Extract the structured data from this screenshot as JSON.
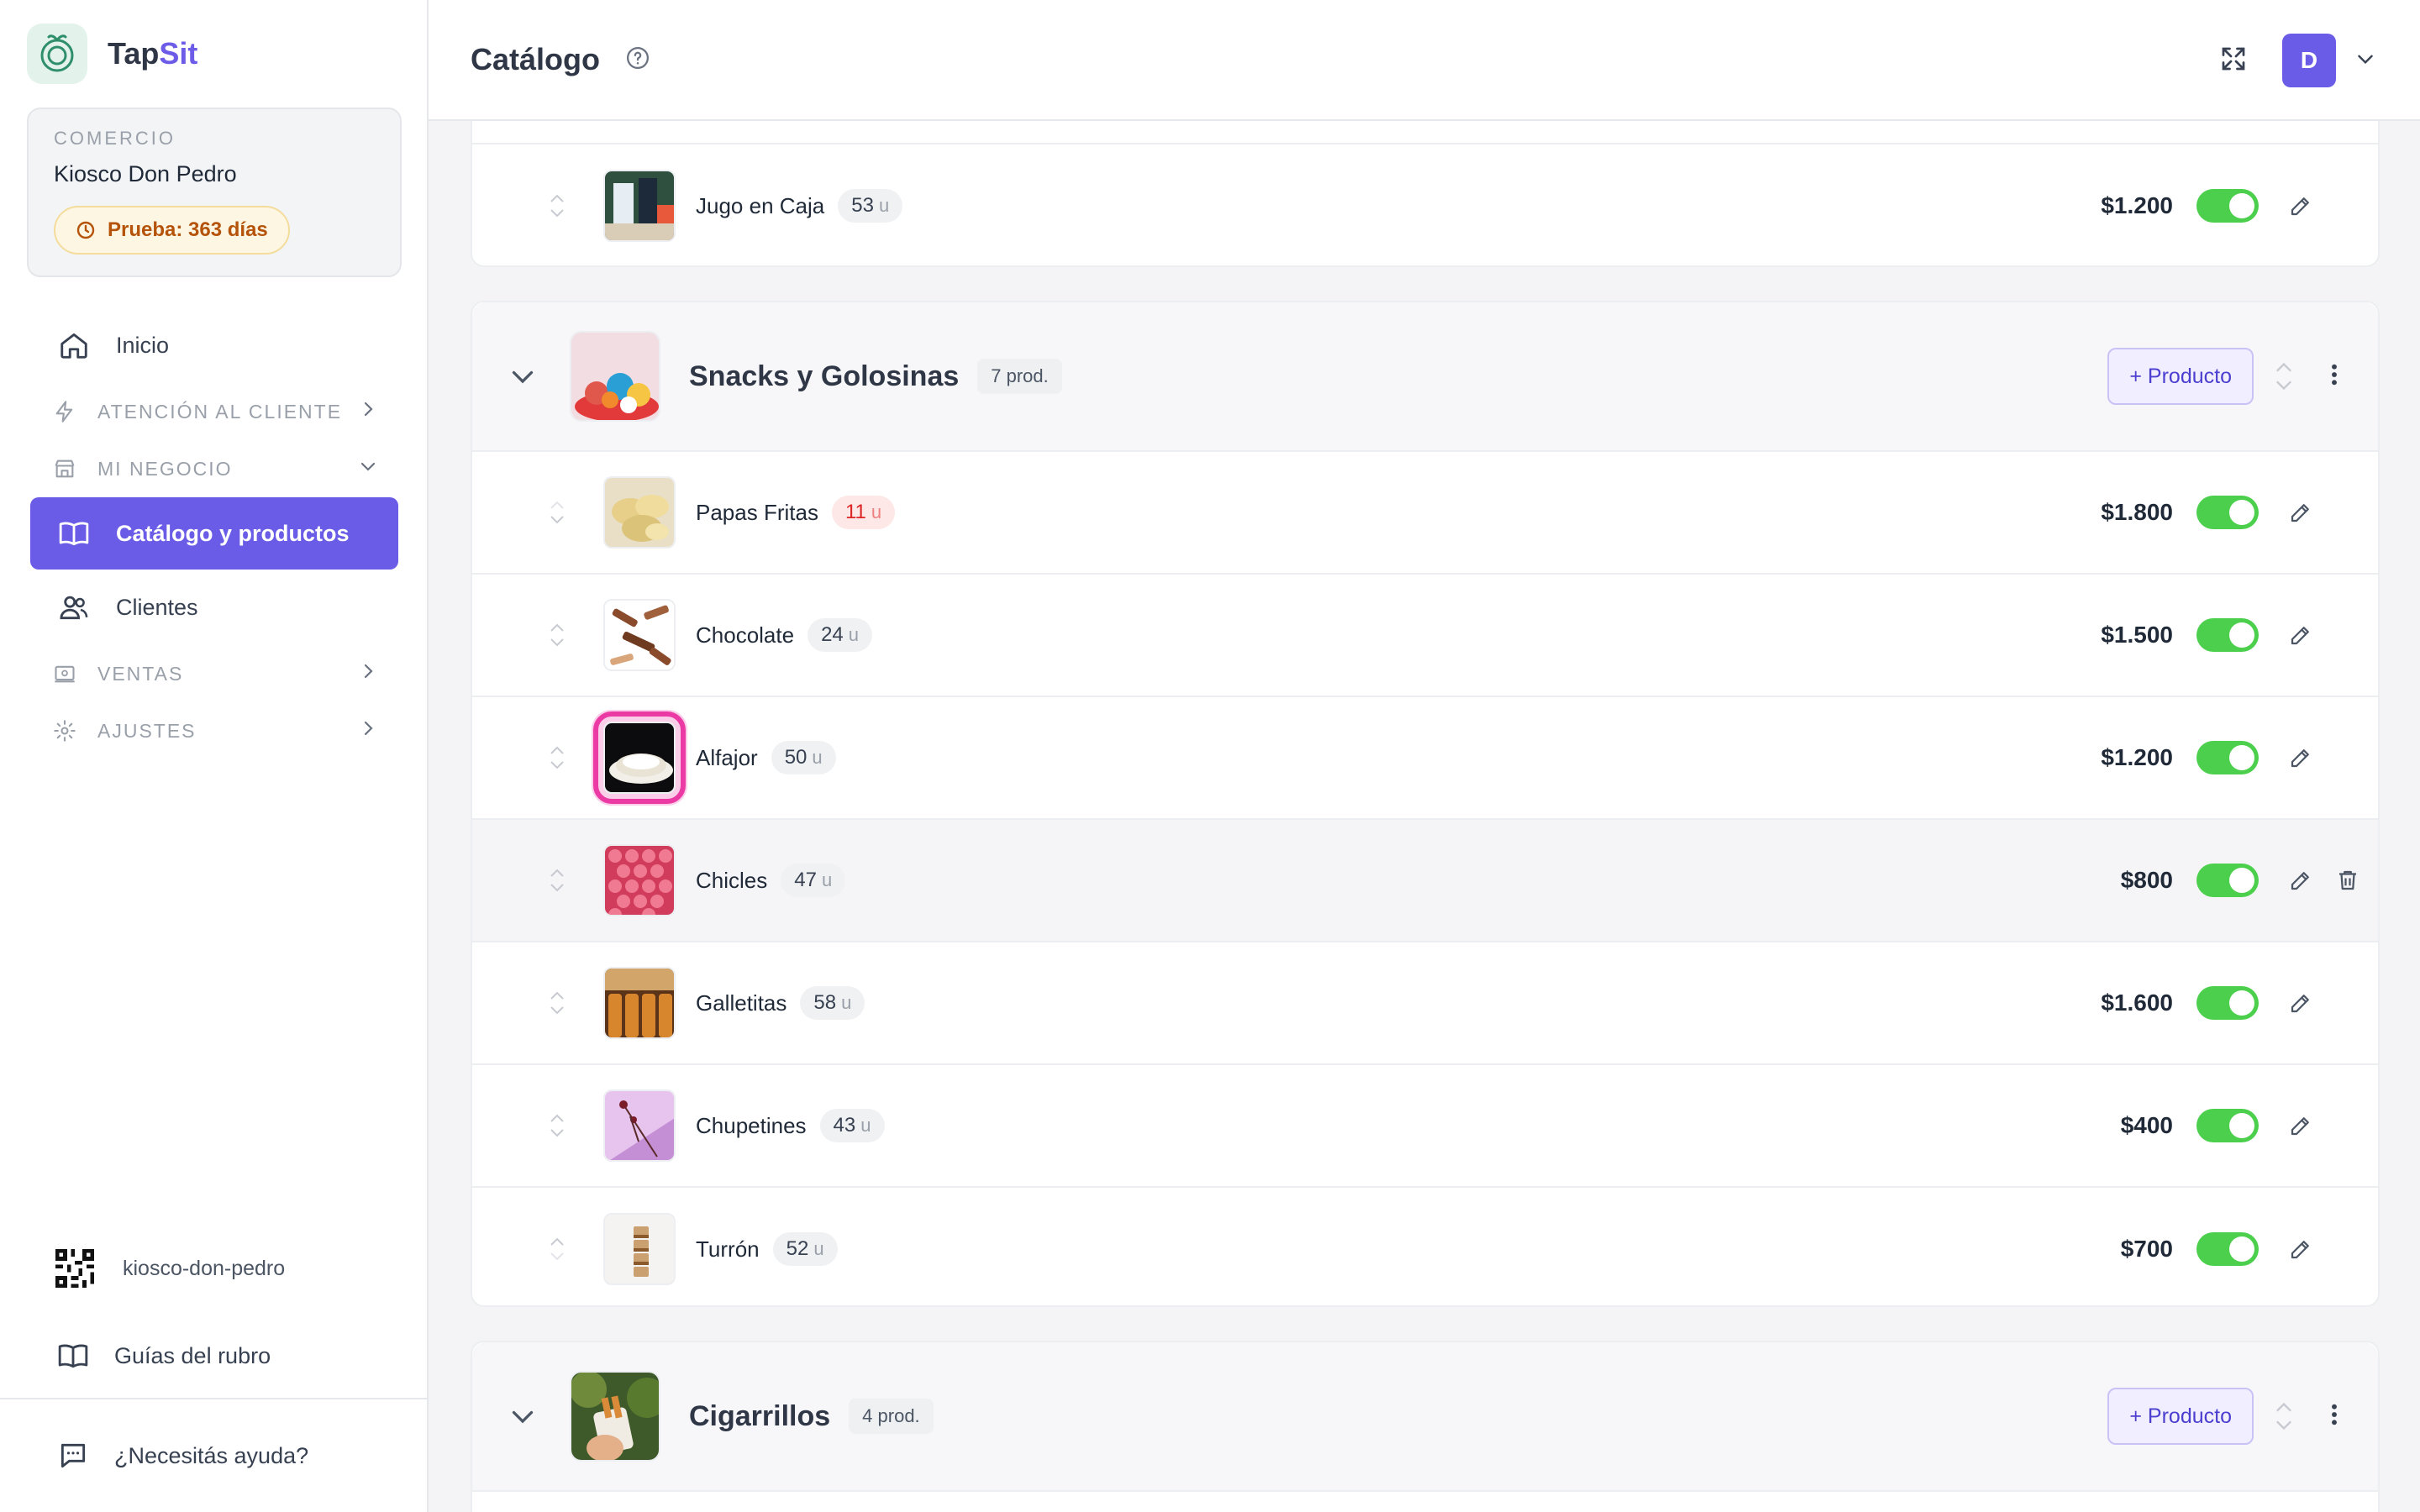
{
  "brand": {
    "name_part1": "Tap",
    "name_part2": "Sit"
  },
  "merchant": {
    "label": "COMERCIO",
    "name": "Kiosco Don Pedro",
    "trial": "Prueba: 363 días"
  },
  "nav": {
    "home": "Inicio",
    "customer_service": "ATENCIÓN AL CLIENTE",
    "my_business": "MI NEGOCIO",
    "catalog": "Catálogo y productos",
    "clients": "Clientes",
    "sales": "VENTAS",
    "settings": "AJUSTES"
  },
  "sidebar_bottom": {
    "slug": "kiosco-don-pedro",
    "guides": "Guías del rubro",
    "help": "¿Necesitás ayuda?"
  },
  "header": {
    "title": "Catálogo",
    "avatar_initial": "D"
  },
  "categories": [
    {
      "name": "Snacks y Golosinas",
      "count": "7 prod.",
      "add_label": "+ Producto",
      "products": [
        {
          "name": "Papas Fritas",
          "stock": "11",
          "unit": "u",
          "price": "$1.800",
          "low": true
        },
        {
          "name": "Chocolate",
          "stock": "24",
          "unit": "u",
          "price": "$1.500"
        },
        {
          "name": "Alfajor",
          "stock": "50",
          "unit": "u",
          "price": "$1.200"
        },
        {
          "name": "Chicles",
          "stock": "47",
          "unit": "u",
          "price": "$800"
        },
        {
          "name": "Galletitas",
          "stock": "58",
          "unit": "u",
          "price": "$1.600"
        },
        {
          "name": "Chupetines",
          "stock": "43",
          "unit": "u",
          "price": "$400"
        },
        {
          "name": "Turrón",
          "stock": "52",
          "unit": "u",
          "price": "$700"
        }
      ]
    },
    {
      "name": "Cigarrillos",
      "count": "4 prod.",
      "add_label": "+ Producto"
    }
  ],
  "previous_category_last_product": {
    "name": "Jugo en Caja",
    "stock": "53",
    "unit": "u",
    "price": "$1.200"
  },
  "colors": {
    "accent": "#6a5ce6",
    "toggle_on": "#4ccf4c",
    "low_stock": "#dc2626",
    "trial": "#b45309"
  }
}
